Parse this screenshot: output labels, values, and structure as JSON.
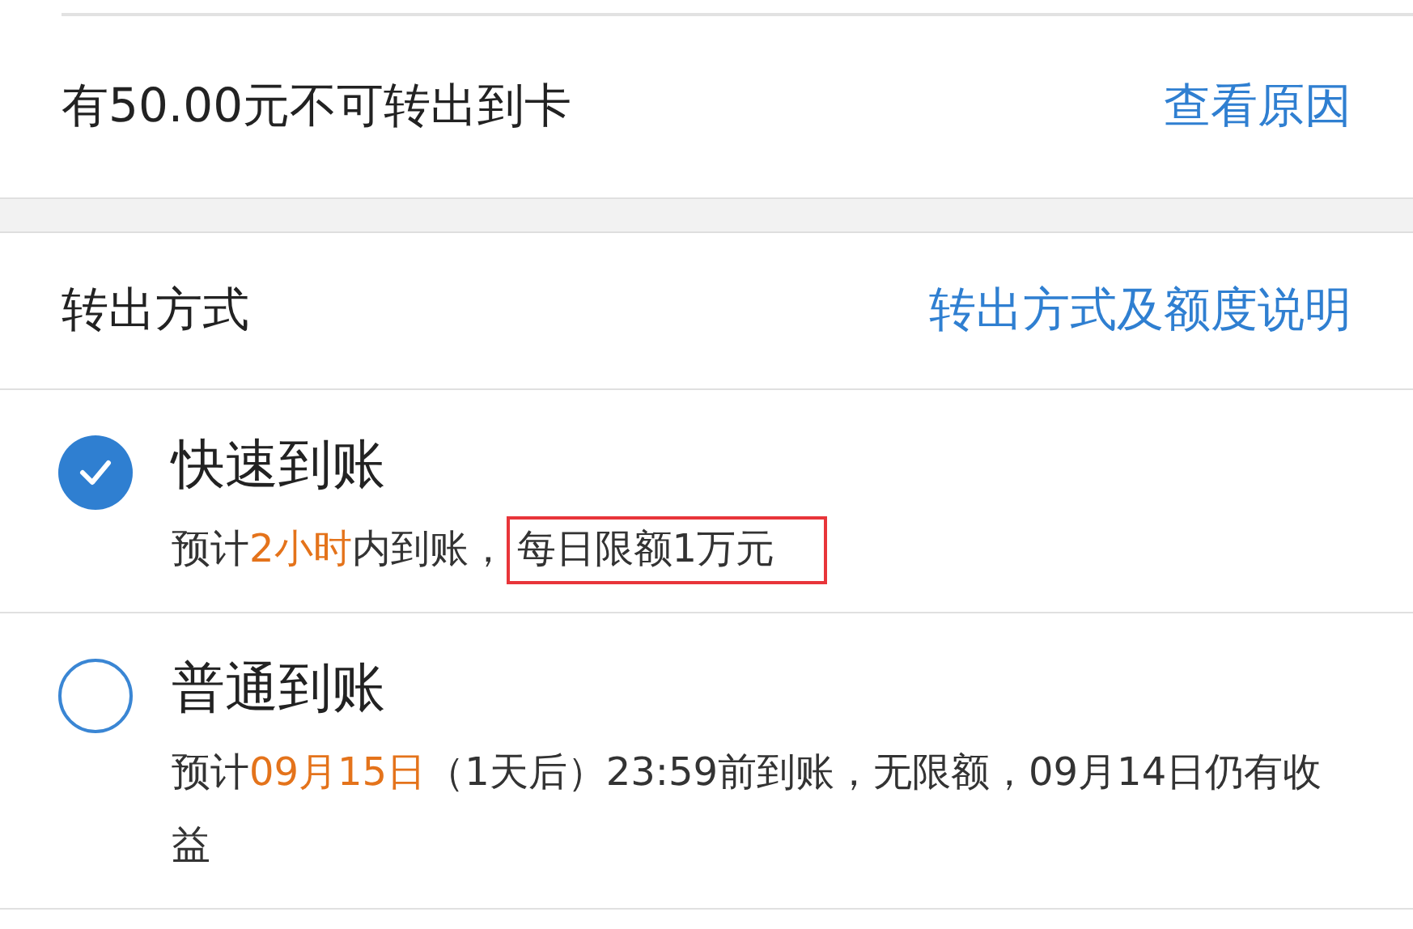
{
  "notice": {
    "text": "有50.00元不可转出到卡",
    "link": "查看原因"
  },
  "method_header": {
    "title": "转出方式",
    "link": "转出方式及额度说明"
  },
  "options": [
    {
      "title": "快速到账",
      "selected": true,
      "description": [
        {
          "text": "预计",
          "highlight": false,
          "boxed": false
        },
        {
          "text": "2小时",
          "highlight": true,
          "boxed": false
        },
        {
          "text": "内到账，",
          "highlight": false,
          "boxed": false
        },
        {
          "text": "每日限额1万元",
          "highlight": false,
          "boxed": true
        }
      ]
    },
    {
      "title": "普通到账",
      "selected": false,
      "description": [
        {
          "text": "预计",
          "highlight": false,
          "boxed": false
        },
        {
          "text": "09月15日",
          "highlight": true,
          "boxed": false
        },
        {
          "text": "（1天后）23:59前到账，无限额，09月14日仍有收益",
          "highlight": false,
          "boxed": false
        }
      ]
    }
  ]
}
